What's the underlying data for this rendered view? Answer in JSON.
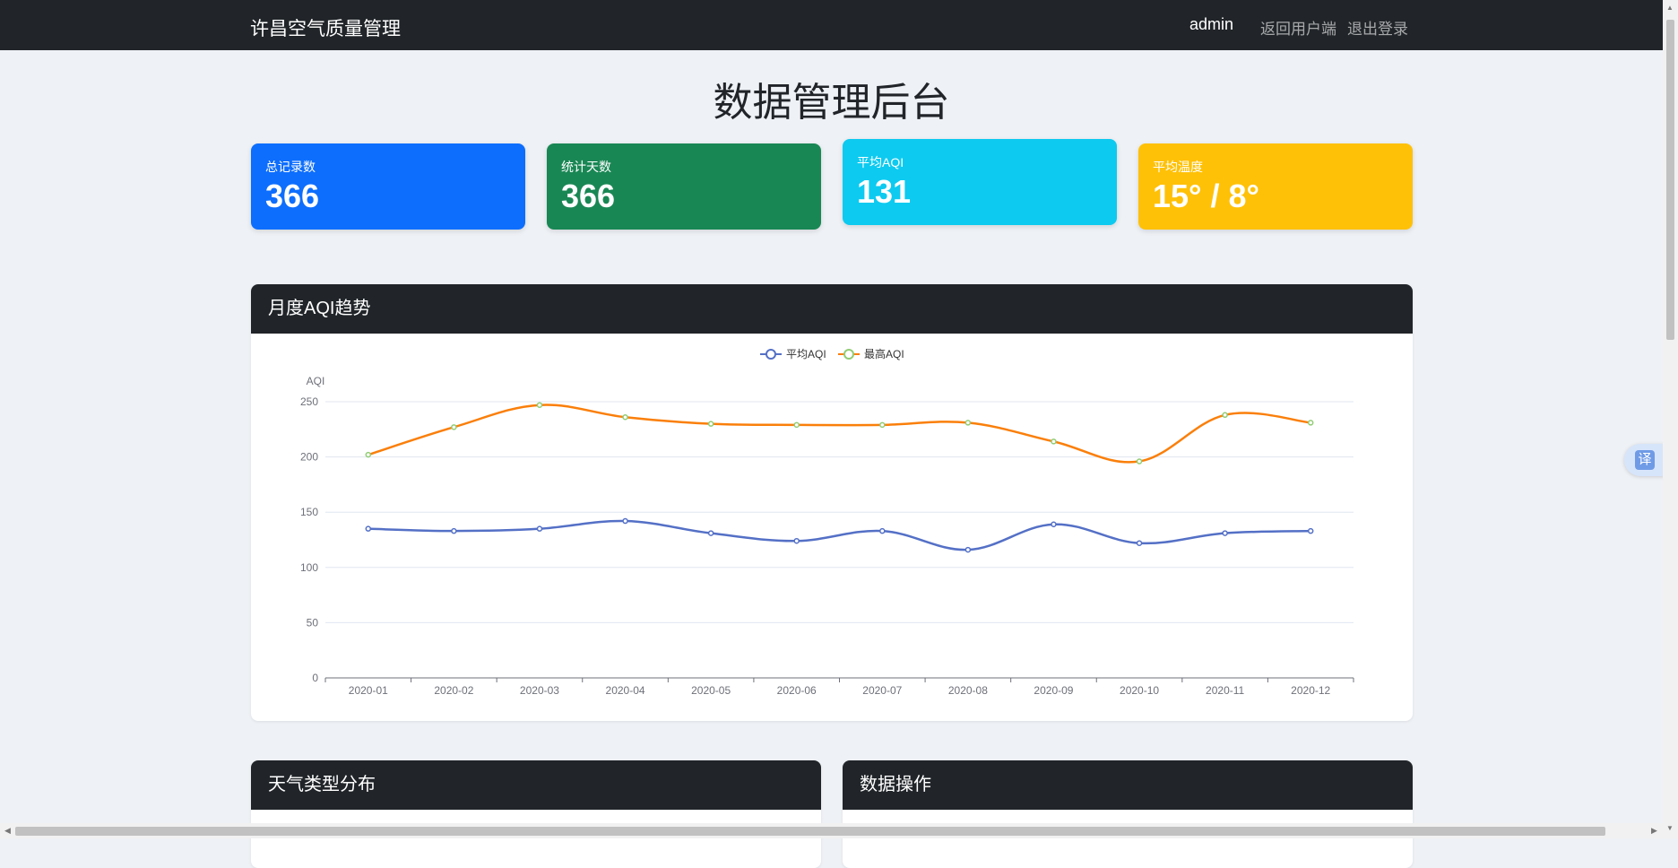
{
  "navbar": {
    "brand": "许昌空气质量管理",
    "user": "admin",
    "back_link": "返回用户端",
    "logout_link": "退出登录"
  },
  "page_title": "数据管理后台",
  "stats": [
    {
      "label": "总记录数",
      "value": "366",
      "color": "#0d6efd"
    },
    {
      "label": "统计天数",
      "value": "366",
      "color": "#198754"
    },
    {
      "label": "平均AQI",
      "value": "131",
      "color": "#0dcaf0"
    },
    {
      "label": "平均温度",
      "value": "15° / 8°",
      "color": "#ffc107"
    }
  ],
  "trend_panel": {
    "title": "月度AQI趋势"
  },
  "weather_panel": {
    "title": "天气类型分布"
  },
  "ops_panel": {
    "title": "数据操作"
  },
  "translate_button": {
    "label": "译"
  },
  "chart_data": {
    "type": "line",
    "title": "",
    "xlabel": "",
    "ylabel": "AQI",
    "categories": [
      "2020-01",
      "2020-02",
      "2020-03",
      "2020-04",
      "2020-05",
      "2020-06",
      "2020-07",
      "2020-08",
      "2020-09",
      "2020-10",
      "2020-11",
      "2020-12"
    ],
    "ylim": [
      0,
      250
    ],
    "yticks": [
      0,
      50,
      100,
      150,
      200,
      250
    ],
    "grid": true,
    "smooth": true,
    "legend": "top-center",
    "series": [
      {
        "name": "平均AQI",
        "color": "#5470c6",
        "values": [
          135,
          133,
          135,
          142,
          131,
          124,
          133,
          116,
          139,
          122,
          131,
          133
        ]
      },
      {
        "name": "最高AQI",
        "color": "#fa7f0a",
        "marker_color": "#91cc75",
        "values": [
          202,
          227,
          247,
          236,
          230,
          229,
          229,
          231,
          214,
          196,
          238,
          231
        ]
      }
    ]
  }
}
